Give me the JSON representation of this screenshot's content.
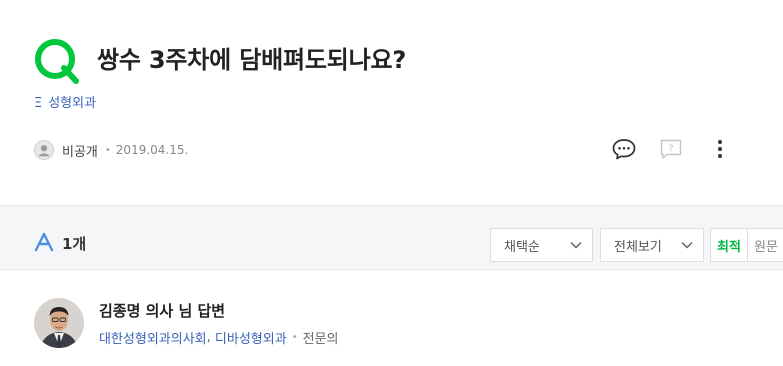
{
  "question": {
    "title": "쌍수 3주차에 담배펴도되나요?",
    "category_tag": "Ξ",
    "category": "성형외과",
    "author": "비공개",
    "date": "2019.04.15."
  },
  "answers_bar": {
    "count_label": "1개",
    "sort_select": "채택순",
    "view_select": "전체보기",
    "latest_label": "최적",
    "original_label": "원문"
  },
  "answer": {
    "name": "김종명 의사 님 답변",
    "affiliation_1": "대한성형외과의사회",
    "separator": ",",
    "affiliation_2": "디바성형외과",
    "role": "전문의"
  },
  "colors": {
    "accent_green": "#00c73c",
    "link_blue": "#3a62b8",
    "answer_icon_blue": "#4a90e2"
  },
  "icons": [
    "q-logo-icon",
    "avatar-icon",
    "comment-icon",
    "report-icon",
    "more-icon",
    "a-logo-icon",
    "chevron-down-icon"
  ]
}
